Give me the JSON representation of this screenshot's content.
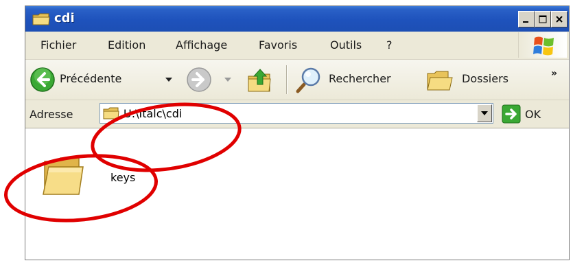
{
  "window": {
    "title": "cdi",
    "controls": {
      "minimize": "minimize",
      "maximize": "maximize",
      "close": "close"
    }
  },
  "menu": {
    "items": [
      "Fichier",
      "Edition",
      "Affichage",
      "Favoris",
      "Outils",
      "?"
    ]
  },
  "toolbar": {
    "back_label": "Précédente",
    "search_label": "Rechercher",
    "folders_label": "Dossiers",
    "more": "»"
  },
  "address": {
    "label": "Adresse",
    "value": "U:\\Italc\\cdi",
    "go_label": "OK"
  },
  "files": [
    {
      "name": "keys",
      "icon": "folder-icon"
    }
  ],
  "colors": {
    "titlebar": "#1e52bc",
    "chrome": "#ece9d8",
    "annotation": "#e00000"
  }
}
